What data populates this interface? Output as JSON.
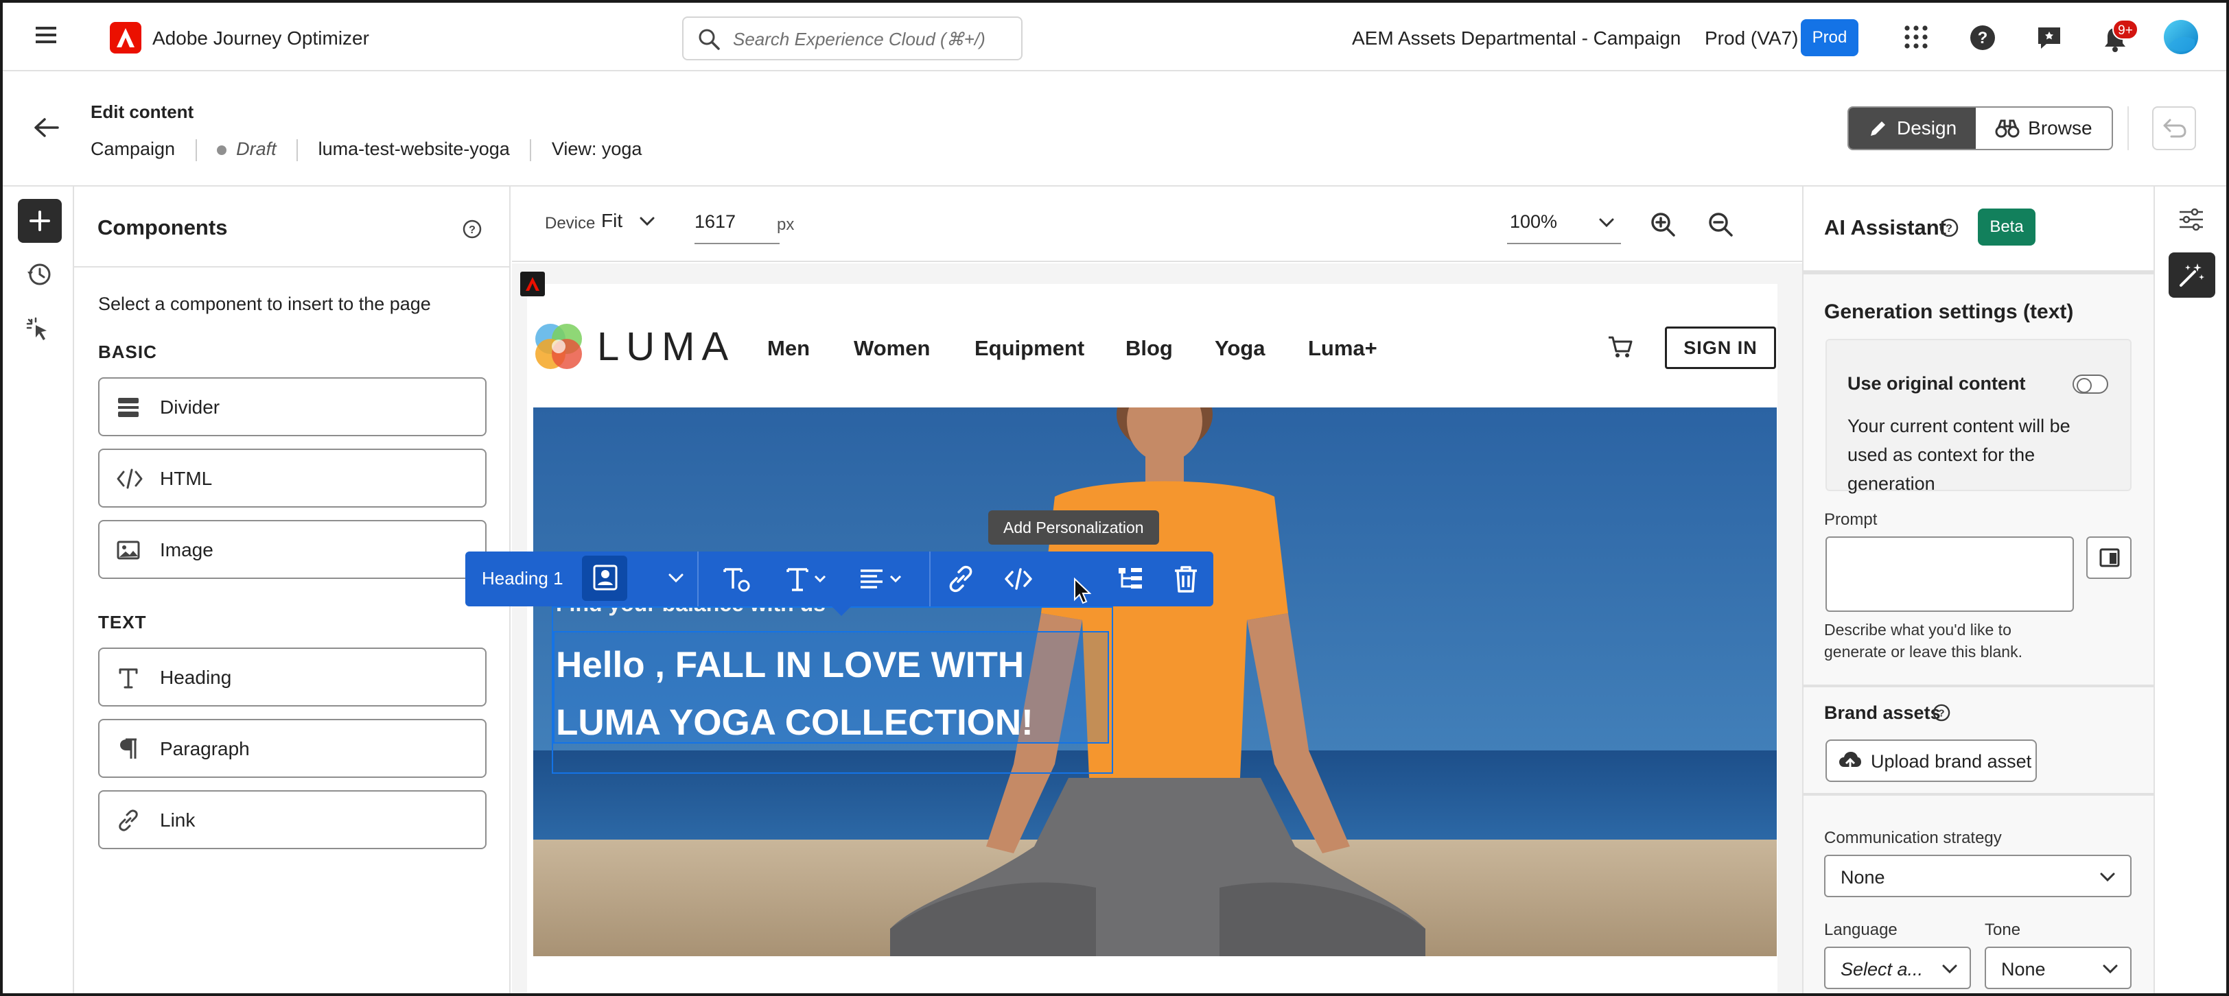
{
  "topbar": {
    "app_name": "Adobe Journey Optimizer",
    "search_placeholder": "Search Experience Cloud (⌘+/)",
    "org_name": "AEM Assets Departmental - Campaign",
    "environment": "Prod (VA7)",
    "env_badge": "Prod",
    "notifications_count": "9+"
  },
  "header": {
    "title": "Edit content",
    "breadcrumb": {
      "campaign": "Campaign",
      "status": "Draft",
      "name": "luma-test-website-yoga",
      "view": "View: yoga"
    },
    "mode_design": "Design",
    "mode_browse": "Browse"
  },
  "components": {
    "title": "Components",
    "hint": "Select a component to insert to the page",
    "basic_label": "BASIC",
    "text_label": "TEXT",
    "basic_items": [
      "Divider",
      "HTML",
      "Image"
    ],
    "text_items": [
      "Heading",
      "Paragraph",
      "Link"
    ]
  },
  "canvas": {
    "device_label": "Device",
    "device_value": "Fit",
    "width_value": "1617",
    "width_unit": "px",
    "zoom": "100%"
  },
  "site": {
    "logo_text": "LUMA",
    "nav": [
      "Men",
      "Women",
      "Equipment",
      "Blog",
      "Yoga",
      "Luma+"
    ],
    "signin": "SIGN IN",
    "hero_sub": "Find your balance with us",
    "hero_heading": "Hello , FALL IN LOVE WITH\nLUMA YOGA COLLECTION!"
  },
  "toolbar": {
    "block_type": "Heading 1",
    "tooltip": "Add Personalization"
  },
  "ai": {
    "title": "AI Assistant",
    "badge": "Beta",
    "gen_title": "Generation settings (text)",
    "use_original": "Use original content",
    "use_original_desc": "Your current content will be used as context for the generation",
    "prompt_label": "Prompt",
    "prompt_help": "Describe what you'd like to generate or leave this blank.",
    "brand_assets": "Brand assets",
    "upload_btn": "Upload brand asset",
    "strategy_label": "Communication strategy",
    "strategy_value": "None",
    "language_label": "Language",
    "language_value": "Select a...",
    "tone_label": "Tone",
    "tone_value": "None"
  },
  "colors": {
    "accent": "#1473e6",
    "toolbar": "#1e63cf",
    "beta": "#12805c",
    "adobe_red": "#eb1000"
  }
}
